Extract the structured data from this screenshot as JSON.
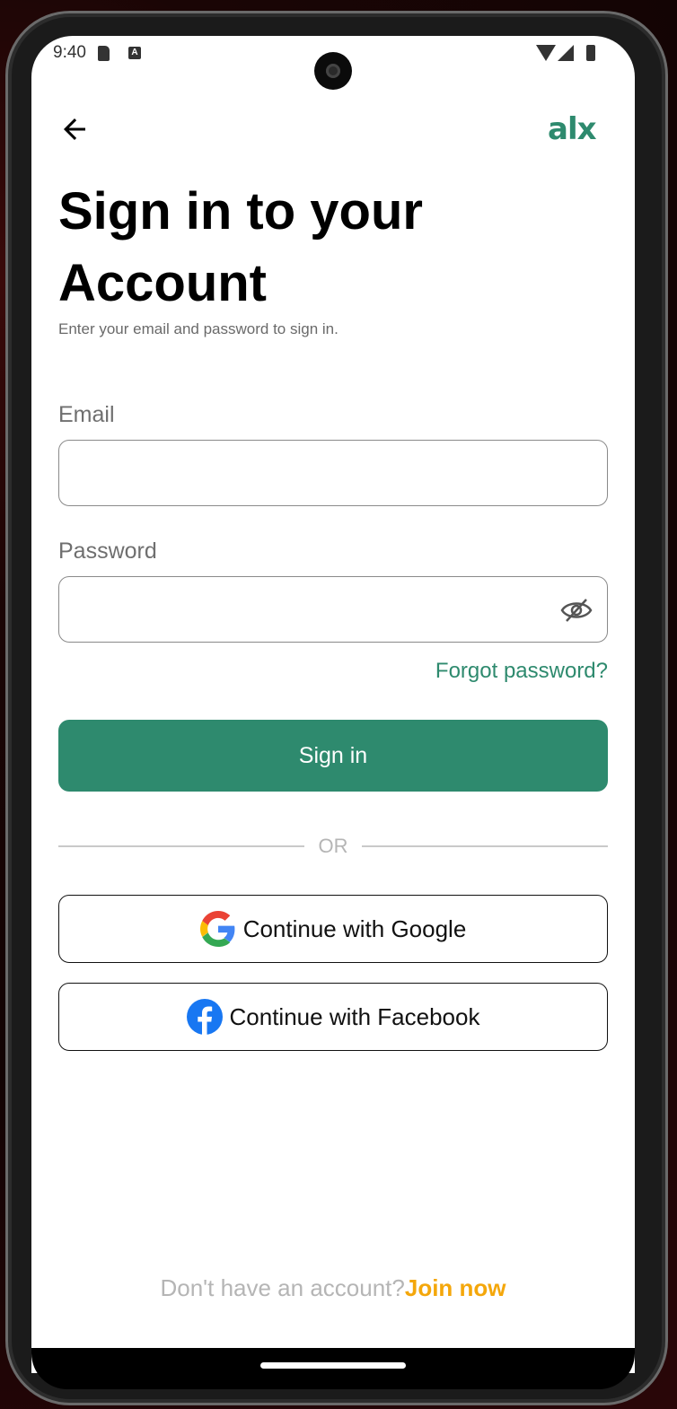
{
  "status_bar": {
    "time": "9:40"
  },
  "header": {
    "logo_text": "alx"
  },
  "main": {
    "title": "Sign in to your Account",
    "subtitle": "Enter your email and password to sign in.",
    "email": {
      "label": "Email",
      "value": "",
      "placeholder": ""
    },
    "password": {
      "label": "Password",
      "value": "",
      "placeholder": ""
    },
    "forgot_password": "Forgot password?",
    "sign_in_label": "Sign in",
    "divider_text": "OR",
    "google_label": "Continue with Google",
    "facebook_label": "Continue with Facebook"
  },
  "footer": {
    "prompt": "Don't have an account?",
    "link": "Join now"
  },
  "colors": {
    "accent": "#2e8a6e",
    "link_orange": "#f4a70b"
  },
  "icons": [
    "back-arrow-icon",
    "eye-off-icon",
    "google-icon",
    "facebook-icon",
    "sd-card-icon",
    "wifi-icon",
    "signal-icon",
    "battery-icon"
  ]
}
